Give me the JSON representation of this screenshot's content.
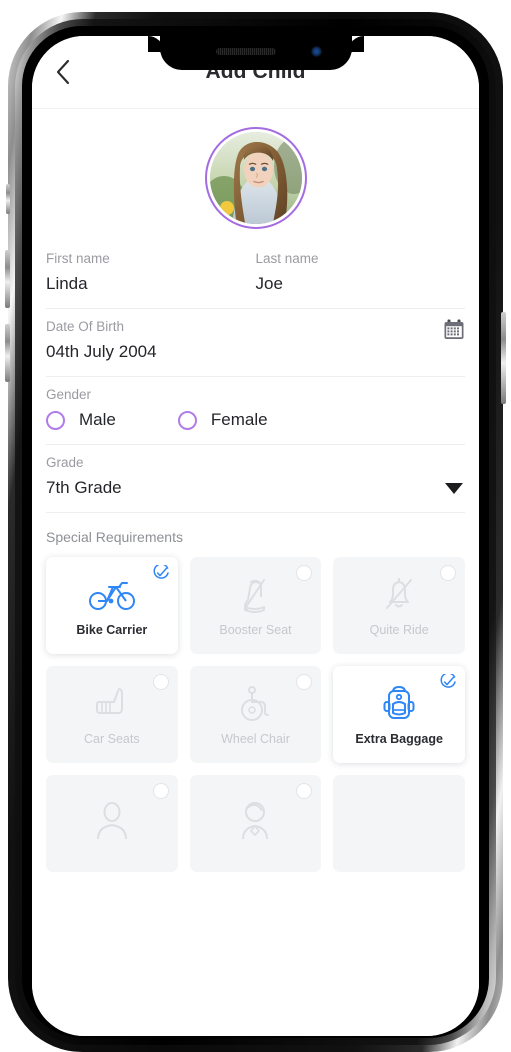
{
  "device": {
    "type": "smartphone-mockup",
    "notch": {
      "speaker": "earpiece-speaker",
      "camera": "front-camera"
    },
    "buttons": [
      "mute-switch",
      "volume-up",
      "volume-down",
      "power"
    ]
  },
  "header": {
    "title": "Add Child",
    "back_icon": "chevron-left-icon"
  },
  "avatar": {
    "alt": "child-profile-photo",
    "ring_color": "#a56be0"
  },
  "form": {
    "first_name": {
      "label": "First name",
      "value": "Linda"
    },
    "last_name": {
      "label": "Last name",
      "value": "Joe"
    },
    "date_of_birth": {
      "label": "Date Of Birth",
      "value": "04th July 2004",
      "icon": "calendar-icon"
    },
    "gender": {
      "label": "Gender",
      "options": [
        {
          "label": "Male",
          "selected": false
        },
        {
          "label": "Female",
          "selected": false
        }
      ],
      "radio_color": "#b07ce8"
    },
    "grade": {
      "label": "Grade",
      "value": "7th Grade",
      "icon": "caret-down-icon"
    }
  },
  "special_requirements": {
    "title": "Special Requirements",
    "accent_color": "#2f86f6",
    "items": [
      {
        "label": "Bike Carrier",
        "icon": "bicycle-icon",
        "selected": true
      },
      {
        "label": "Booster Seat",
        "icon": "booster-seat-icon",
        "selected": false
      },
      {
        "label": "Quite Ride",
        "icon": "bell-off-icon",
        "selected": false
      },
      {
        "label": "Car Seats",
        "icon": "car-seat-icon",
        "selected": false
      },
      {
        "label": "Wheel Chair",
        "icon": "wheelchair-icon",
        "selected": false
      },
      {
        "label": "Extra Baggage",
        "icon": "backpack-icon",
        "selected": true
      },
      {
        "label": "",
        "icon": "person-icon",
        "selected": false
      },
      {
        "label": "",
        "icon": "person-female-icon",
        "selected": false
      },
      {
        "label": "",
        "icon": "",
        "selected": false
      }
    ]
  }
}
